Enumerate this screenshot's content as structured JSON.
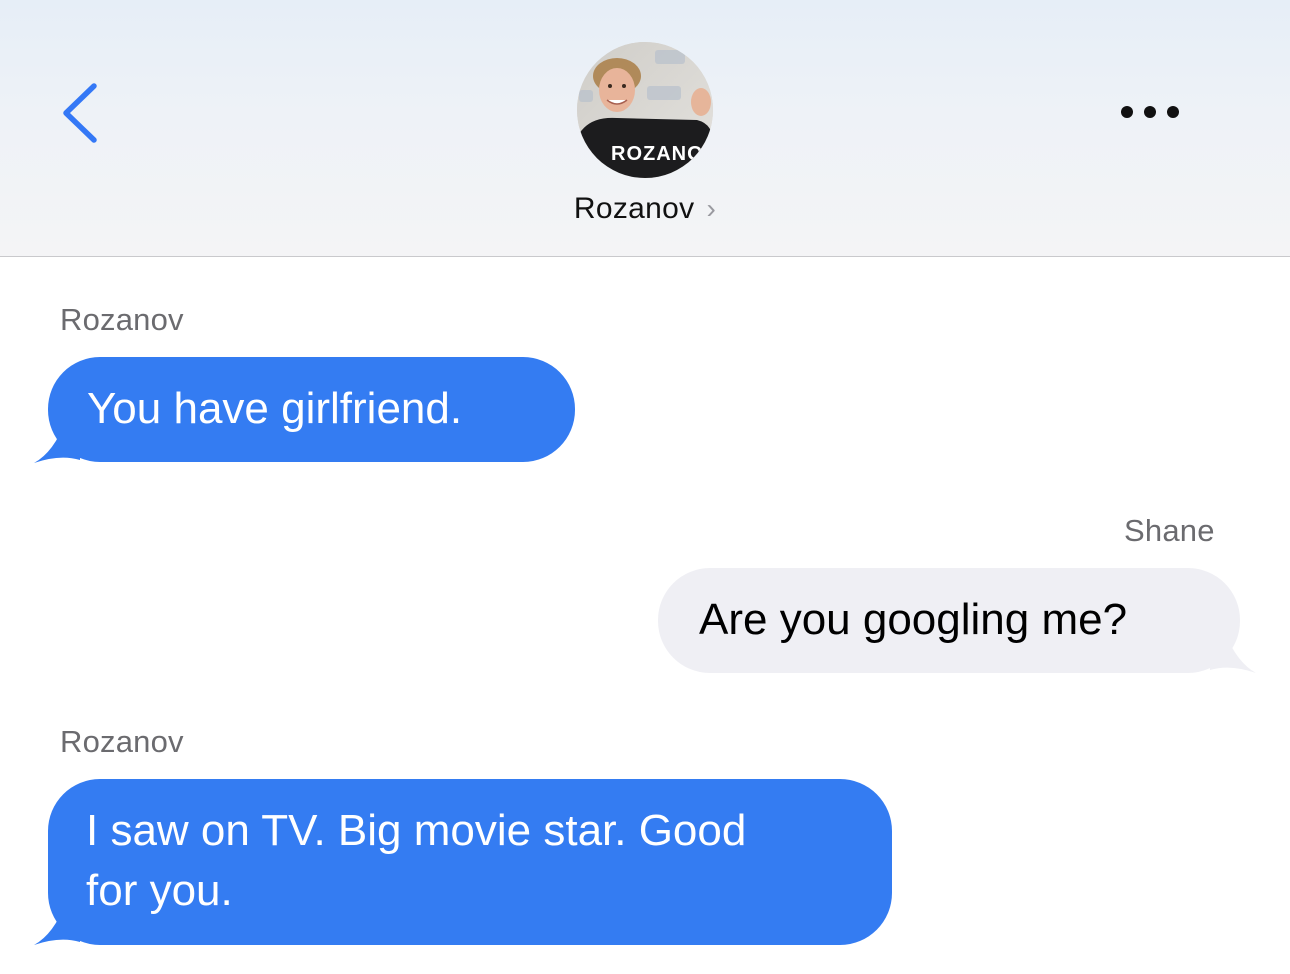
{
  "header": {
    "contact_name": "Rozanov",
    "contact_chevron": "›",
    "avatar_jersey_text": "ROZANOV",
    "icons": {
      "back": "chevron-left-icon",
      "more": "ellipsis-icon",
      "contact_chevron": "chevron-right-icon"
    }
  },
  "colors": {
    "incoming_bubble": "#347cf2",
    "outgoing_bubble": "#efeff4",
    "accent": "#3478f6"
  },
  "messages": [
    {
      "sender": "Rozanov",
      "text": "You have girlfriend.",
      "direction": "incoming"
    },
    {
      "sender": "Shane",
      "text": "Are you googling me?",
      "direction": "outgoing"
    },
    {
      "sender": "Rozanov",
      "text_line1": "I saw on TV. Big movie star. Good",
      "text_line2": "for you.",
      "direction": "incoming"
    }
  ]
}
